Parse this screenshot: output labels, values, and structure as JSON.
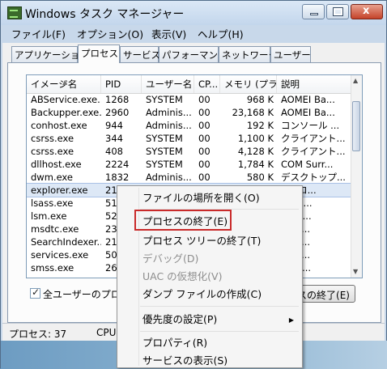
{
  "window": {
    "title": "Windows タスク マネージャー"
  },
  "menu": [
    "ファイル(F)",
    "オプション(O)",
    "表示(V)",
    "ヘルプ(H)"
  ],
  "tabs": [
    "アプリケーション",
    "プロセス",
    "サービス",
    "パフォーマンス",
    "ネットワーク",
    "ユーザー"
  ],
  "active_tab": "プロセス",
  "columns": [
    "イメージ名",
    "PID",
    "ユーザー名",
    "CP...",
    "メモリ (プラ...",
    "説明"
  ],
  "rows": [
    [
      "ABService.exe...",
      "1268",
      "SYSTEM",
      "00",
      "968 K",
      "AOMEI Ba..."
    ],
    [
      "Backupper.exe...",
      "2960",
      "Adminis...",
      "00",
      "23,168 K",
      "AOMEI Ba..."
    ],
    [
      "conhost.exe",
      "944",
      "Adminis...",
      "00",
      "192 K",
      "コンソール ..."
    ],
    [
      "csrss.exe",
      "344",
      "SYSTEM",
      "00",
      "1,100 K",
      "クライアント..."
    ],
    [
      "csrss.exe",
      "408",
      "SYSTEM",
      "00",
      "4,128 K",
      "クライアント..."
    ],
    [
      "dllhost.exe",
      "2224",
      "SYSTEM",
      "00",
      "1,784 K",
      "COM Surr..."
    ],
    [
      "dwm.exe",
      "1832",
      "Adminis...",
      "00",
      "580 K",
      "デスクトップ..."
    ],
    [
      "explorer.exe",
      "21",
      "",
      "",
      "",
      "s プロ..."
    ],
    [
      "lsass.exe",
      "51",
      "",
      "",
      "",
      "l Sec..."
    ],
    [
      "lsm.exe",
      "52",
      "",
      "",
      "",
      "ル セ..."
    ],
    [
      "msdtc.exe",
      "23",
      "",
      "",
      "",
      "soft ..."
    ],
    [
      "SearchIndexer...",
      "21",
      "",
      "",
      "",
      "soft ..."
    ],
    [
      "services.exe",
      "50",
      "",
      "",
      "",
      "soft ..."
    ],
    [
      "smss.exe",
      "26",
      "",
      "",
      "",
      "ows ..."
    ]
  ],
  "selected_row": "explorer.exe",
  "show_all_users_label": "全ユーザーのプロセ",
  "end_process_button": "スの終了(E)",
  "status": {
    "processes": "プロセス: 37",
    "cpu": "CPU"
  },
  "context_menu": {
    "items": [
      {
        "label": "ファイルの場所を開く(O)",
        "disabled": false
      },
      {
        "label": "プロセスの終了(E)",
        "disabled": false,
        "highlighted": true
      },
      {
        "label": "プロセス ツリーの終了(T)",
        "disabled": false
      },
      {
        "label": "デバッグ(D)",
        "disabled": true
      },
      {
        "label": "UAC の仮想化(V)",
        "disabled": true
      },
      {
        "label": "ダンプ ファイルの作成(C)",
        "disabled": false
      },
      {
        "label": "優先度の設定(P)",
        "disabled": false,
        "submenu": true
      },
      {
        "label": "プロパティ(R)",
        "disabled": false
      },
      {
        "label": "サービスの表示(S)",
        "disabled": false
      }
    ]
  },
  "colors": {
    "highlight_box": "#c92a2a",
    "selection": "#dde8f6",
    "frame": "#c8d8ea"
  },
  "icons": [
    "task-manager-app-icon",
    "minimize-icon",
    "maximize-icon",
    "close-icon",
    "checkbox-checked-icon",
    "submenu-arrow-icon",
    "sort-arrow-icon"
  ]
}
